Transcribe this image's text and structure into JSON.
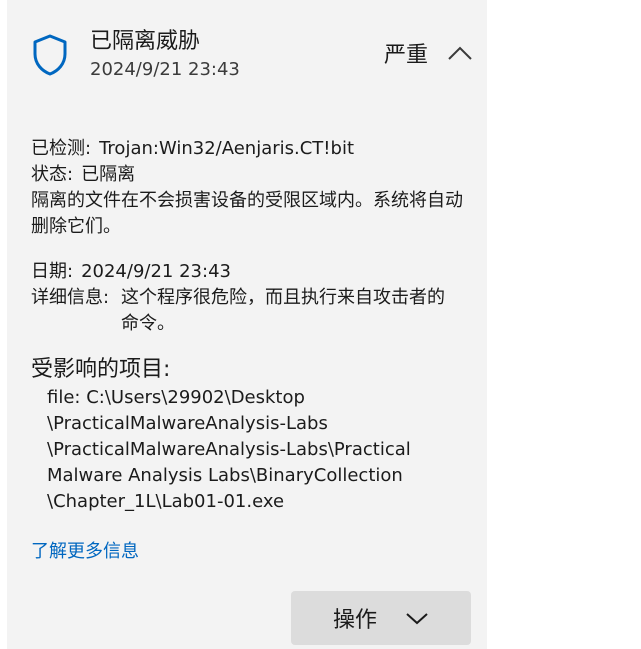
{
  "header": {
    "title": "已隔离威胁",
    "date": "2024/9/21 23:43",
    "severity": "严重",
    "shield_icon": "shield-icon",
    "collapse_icon": "chevron-up-icon"
  },
  "info": {
    "detected_label": "已检测:",
    "detected_value": "Trojan:Win32/Aenjaris.CT!bit",
    "status_label": "状态:",
    "status_value": "已隔离",
    "description": "隔离的文件在不会损害设备的受限区域内。系统将自动删除它们。",
    "date_label": "日期:",
    "date_value": "2024/9/21 23:43",
    "details_label": "详细信息:",
    "details_value": "这个程序很危险，而且执行来自攻击者的命令。"
  },
  "affected": {
    "heading": "受影响的项目:",
    "lines": [
      "file: C:\\Users\\29902\\Desktop",
      "\\PracticalMalwareAnalysis-Labs",
      "\\PracticalMalwareAnalysis-Labs\\Practical",
      "Malware Analysis Labs\\BinaryCollection",
      "\\Chapter_1L\\Lab01-01.exe"
    ]
  },
  "links": {
    "learn_more": "了解更多信息"
  },
  "actions": {
    "button_label": "操作",
    "chevron_icon": "chevron-down-icon"
  },
  "colors": {
    "accent": "#0067c0",
    "panel_bg": "#f3f3f3",
    "button_bg": "#dcdcdc"
  }
}
